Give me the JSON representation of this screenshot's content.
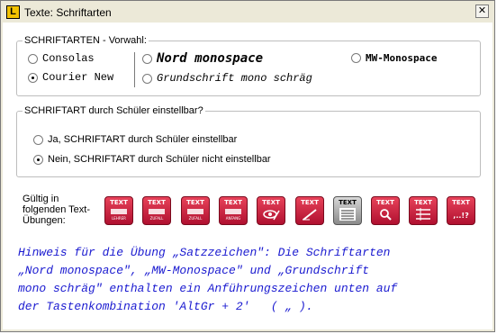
{
  "window": {
    "title": "Texte: Schriftarten",
    "app_icon_letter": "L",
    "close_glyph": "✕"
  },
  "group_font": {
    "legend": "SCHRIFTARTEN - Vorwahl:",
    "options": [
      {
        "label": "Consolas",
        "checked": false
      },
      {
        "label": "Courier New",
        "checked": true
      },
      {
        "label": "Nord monospace",
        "checked": false
      },
      {
        "label": "Grundschrift mono schräg",
        "checked": false
      },
      {
        "label": "MW-Monospace",
        "checked": false
      }
    ]
  },
  "group_student": {
    "legend": "SCHRIFTART durch Schüler einstellbar?",
    "options": [
      {
        "label": "Ja, SCHRIFTART durch Schüler einstellbar",
        "checked": false
      },
      {
        "label": "Nein, SCHRIFTART durch Schüler nicht einstellbar",
        "checked": true
      }
    ]
  },
  "exercises": {
    "label": "Gültig in folgenden Text-Übungen:",
    "buttons": [
      {
        "caption": "TEXT",
        "icon": "text-lehrer-icon",
        "sub": "LEHRER"
      },
      {
        "caption": "TEXT",
        "icon": "text-zufall-icon",
        "sub": "ZUFALL"
      },
      {
        "caption": "TEXT",
        "icon": "text-zufall2-icon",
        "sub": "ZUFALL"
      },
      {
        "caption": "TEXT",
        "icon": "text-anfang-icon",
        "sub": "ANFANG"
      },
      {
        "caption": "TEXT",
        "icon": "text-eye-pen-icon",
        "sub": ""
      },
      {
        "caption": "TEXT",
        "icon": "text-pen-icon",
        "sub": ""
      },
      {
        "caption": "TEXT",
        "icon": "text-lines-icon",
        "sub": ""
      },
      {
        "caption": "TEXT",
        "icon": "text-search-icon",
        "sub": ""
      },
      {
        "caption": "TEXT",
        "icon": "text-list-icon",
        "sub": ""
      },
      {
        "caption": "TEXT",
        "icon": "text-punctuation-icon",
        "sub": ",..!?"
      }
    ]
  },
  "hint": {
    "lines": [
      "Hinweis für die Übung „Satzzeichen\": Die Schriftarten",
      "„Nord monospace\", „MW-Monospace\" und „Grundschrift",
      "mono schräg\" enthalten ein Anführungszeichen unten auf",
      "der Tastenkombination 'AltGr + 2'   ( „ )."
    ]
  }
}
